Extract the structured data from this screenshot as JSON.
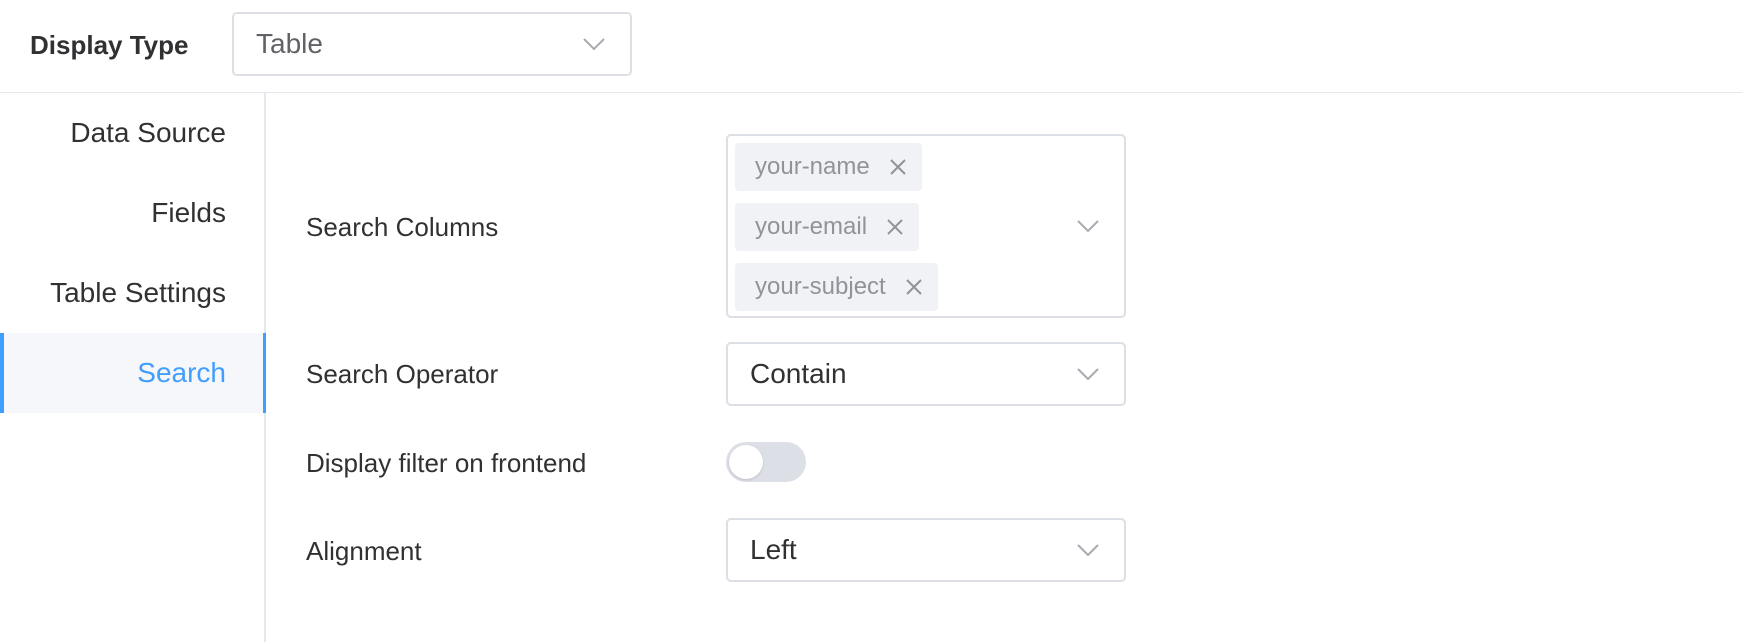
{
  "header": {
    "display_type_label": "Display Type",
    "display_type_value": "Table"
  },
  "sidebar": {
    "items": [
      {
        "label": "Data Source",
        "active": false
      },
      {
        "label": "Fields",
        "active": false
      },
      {
        "label": "Table Settings",
        "active": false
      },
      {
        "label": "Search",
        "active": true
      }
    ]
  },
  "form": {
    "search_columns": {
      "label": "Search Columns",
      "tags": [
        "your-name",
        "your-email",
        "your-subject"
      ]
    },
    "search_operator": {
      "label": "Search Operator",
      "value": "Contain"
    },
    "display_filter": {
      "label": "Display filter on frontend",
      "enabled": false
    },
    "alignment": {
      "label": "Alignment",
      "value": "Left"
    }
  },
  "colors": {
    "accent": "#409eff",
    "border": "#dcdfe6",
    "tag_bg": "#f0f2f5",
    "toggle_off": "#dcdfe6"
  },
  "icons": {
    "select_arrow": "chevron-down-icon",
    "tag_remove": "close-icon"
  }
}
